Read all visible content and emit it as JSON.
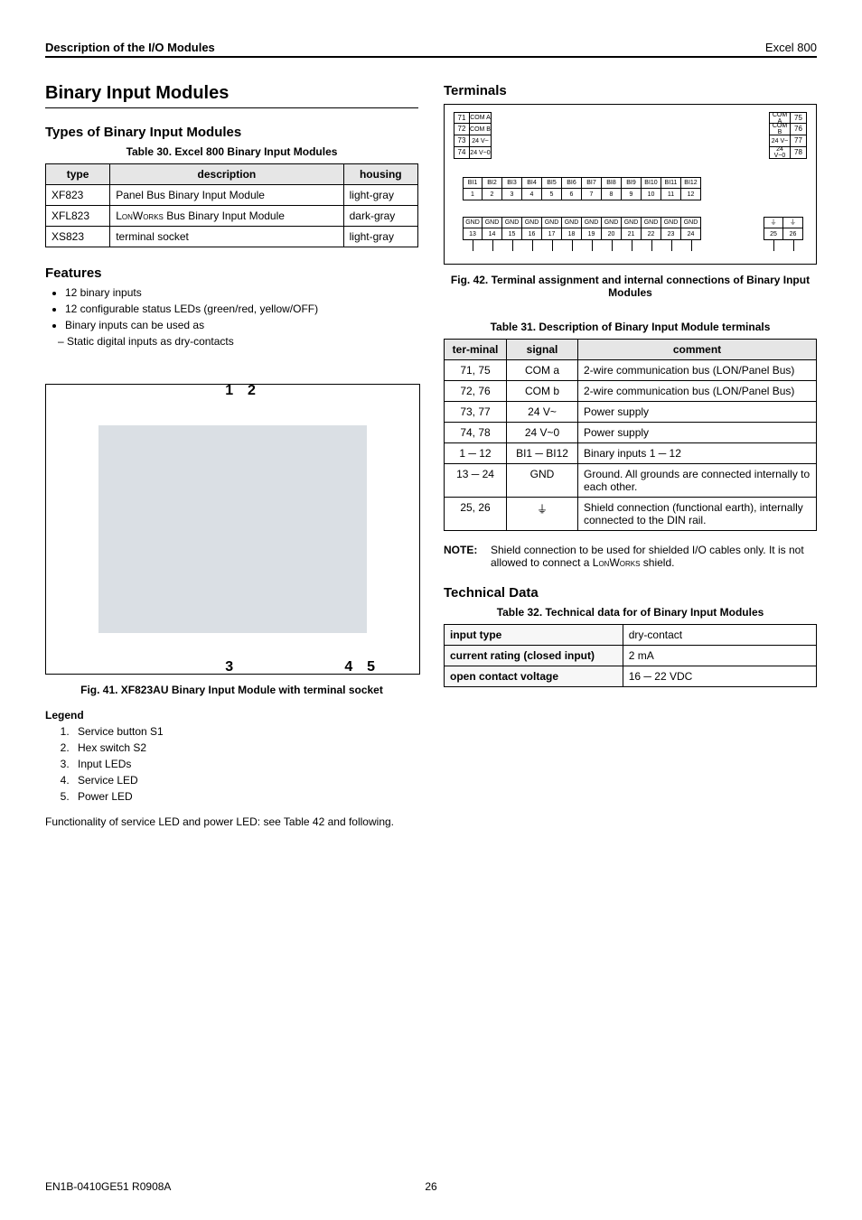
{
  "header": {
    "left": "Description of the I/O Modules",
    "right": "Excel 800"
  },
  "left": {
    "h2": "Binary Input Modules",
    "types_title": "Types of Binary Input Modules",
    "table30": {
      "caption": "Table 30. Excel 800 Binary Input Modules",
      "head": {
        "c1": "type",
        "c2": "description",
        "c3": "housing"
      },
      "rows": [
        {
          "c1": "XF823",
          "c2": "Panel Bus Binary Input Module",
          "c3": "light-gray"
        },
        {
          "c1": "XFL823",
          "c2_prefix": "L",
          "c2_sc": "on",
          "c2_mid": "W",
          "c2_sc2": "orks",
          "c2_suffix": " Bus Binary Input Module",
          "c3": "dark-gray"
        },
        {
          "c1": "XS823",
          "c2": "terminal socket",
          "c3": "light-gray"
        }
      ]
    },
    "features_title": "Features",
    "features": [
      "12 binary inputs",
      "12 configurable status LEDs (green/red, yellow/OFF)",
      "Binary inputs can be used as"
    ],
    "features_sub": "Static digital inputs as dry-contacts",
    "fig41": {
      "n1": "1",
      "n2": "2",
      "n3": "3",
      "n4": "4",
      "n5": "5",
      "caption": "Fig. 41. XF823AU Binary Input Module with terminal socket"
    },
    "legend_title": "Legend",
    "legend": [
      "Service button S1",
      "Hex switch S2",
      "Input LEDs",
      "Service LED",
      "Power LED"
    ],
    "func_text": "Functionality of service LED and power LED: see Table 42 and following."
  },
  "right": {
    "terminals_title": "Terminals",
    "diagram": {
      "left_top": [
        {
          "n": "71",
          "l": "COM A"
        },
        {
          "n": "72",
          "l": "COM B"
        },
        {
          "n": "73",
          "l": "24 V~"
        },
        {
          "n": "74",
          "l": "24 V~0"
        }
      ],
      "right_top": [
        {
          "l": "COM A",
          "n": "75"
        },
        {
          "l": "COM B",
          "n": "76"
        },
        {
          "l": "24 V~",
          "n": "77"
        },
        {
          "l": "24 V~0",
          "n": "78"
        }
      ],
      "bi_labels": [
        "BI1",
        "BI2",
        "BI3",
        "BI4",
        "BI5",
        "BI6",
        "BI7",
        "BI8",
        "BI9",
        "BI10",
        "BI11",
        "BI12"
      ],
      "bi_nums": [
        "1",
        "2",
        "3",
        "4",
        "5",
        "6",
        "7",
        "8",
        "9",
        "10",
        "11",
        "12"
      ],
      "gnd_label": "GND",
      "gnd_nums": [
        "13",
        "14",
        "15",
        "16",
        "17",
        "18",
        "19",
        "20",
        "21",
        "22",
        "23",
        "24"
      ],
      "shield_nums": [
        "25",
        "26"
      ]
    },
    "fig42_caption": "Fig. 42. Terminal assignment and internal connections of Binary Input Modules",
    "table31": {
      "caption": "Table 31. Description of Binary Input Module terminals",
      "head": {
        "c1": "ter-minal",
        "c2": "signal",
        "c3": "comment"
      },
      "rows": [
        {
          "c1": "71, 75",
          "c2": "COM a",
          "c3": "2-wire communication bus (LON/Panel Bus)"
        },
        {
          "c1": "72, 76",
          "c2": "COM b",
          "c3": "2-wire communication bus (LON/Panel Bus)"
        },
        {
          "c1": "73, 77",
          "c2": "24 V~",
          "c3": "Power supply"
        },
        {
          "c1": "74, 78",
          "c2": "24 V~0",
          "c3": "Power supply"
        },
        {
          "c1": "1 ─ 12",
          "c2": "BI1 ─ BI12",
          "c3": "Binary inputs 1 ─ 12"
        },
        {
          "c1": "13 ─ 24",
          "c2": "GND",
          "c3": "Ground. All grounds are connected internally to each other."
        },
        {
          "c1": "25, 26",
          "c2": "⏚",
          "c3": "Shield connection (functional earth), internally connected to the DIN rail."
        }
      ]
    },
    "note": {
      "label": "NOTE:",
      "text_pre": "Shield connection to be used for shielded I/O cables only. It is not allowed to connect a ",
      "text_sc_l": "L",
      "text_sc_on": "on",
      "text_sc_w": "W",
      "text_sc_orks": "orks",
      "text_post": " shield."
    },
    "tech_title": "Technical Data",
    "table32": {
      "caption": "Table 32. Technical data for of Binary Input Modules",
      "rows": [
        {
          "c1": "input type",
          "c2": "dry-contact"
        },
        {
          "c1": "current rating (closed input)",
          "c2": "2 mA"
        },
        {
          "c1": "open contact voltage",
          "c2": "16 ─ 22 VDC"
        }
      ]
    }
  },
  "footer": {
    "left": "EN1B-0410GE51 R0908A",
    "page": "26"
  }
}
